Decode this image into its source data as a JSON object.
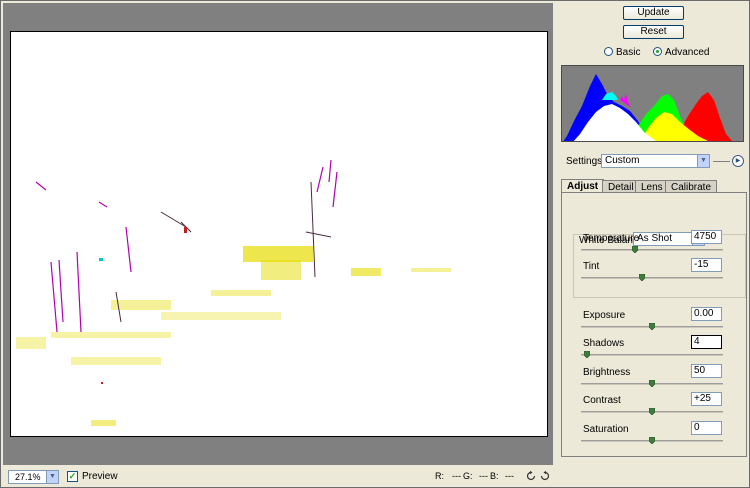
{
  "buttons": {
    "update": "Update",
    "reset": "Reset"
  },
  "mode": {
    "basic": "Basic",
    "advanced": "Advanced",
    "selected": "advanced"
  },
  "settings": {
    "label": "Settings:",
    "value": "Custom"
  },
  "tabs": [
    {
      "label": "Adjust",
      "active": true
    },
    {
      "label": "Detail",
      "active": false
    },
    {
      "label": "Lens",
      "active": false
    },
    {
      "label": "Calibrate",
      "active": false
    }
  ],
  "white_balance": {
    "label": "White Balance:",
    "value": "As Shot"
  },
  "controls": {
    "temperature": {
      "label": "Temperature",
      "value": "4750",
      "level": 0.38
    },
    "tint": {
      "label": "Tint",
      "value": "-15",
      "level": 0.43
    },
    "exposure": {
      "label": "Exposure",
      "value": "0.00",
      "level": 0.5
    },
    "shadows": {
      "label": "Shadows",
      "value": "4",
      "level": 0.04
    },
    "brightness": {
      "label": "Brightness",
      "value": "50",
      "level": 0.5
    },
    "contrast": {
      "label": "Contrast",
      "value": "+25",
      "level": 0.5
    },
    "saturation": {
      "label": "Saturation",
      "value": "0",
      "level": 0.5
    }
  },
  "status": {
    "zoom": "27.1%",
    "preview_label": "Preview",
    "preview_checked": true,
    "r": "R:",
    "r_val": "---",
    "g": "G:",
    "g_val": "---",
    "b": "B:",
    "b_val": "---"
  },
  "icons": {
    "rotate_left": "rotate-left-icon",
    "rotate_right": "rotate-right-icon",
    "settings_menu": "play-circle-icon",
    "dropdown": "chevron-down-icon"
  },
  "colors": {
    "background": "#ece9d8",
    "preview_gray": "#808080",
    "histogram_blue": "#0000ff",
    "histogram_green": "#00ff00",
    "histogram_red": "#ff0000",
    "histogram_yellow": "#ffff00",
    "histogram_white": "#ffffff",
    "histogram_magenta": "#ff00ff"
  }
}
